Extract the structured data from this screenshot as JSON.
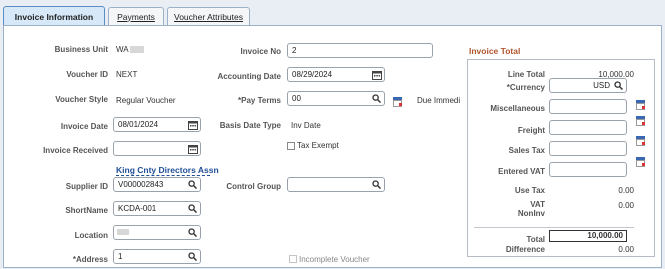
{
  "tabs": [
    {
      "label": "Invoice Information"
    },
    {
      "label": "Payments"
    },
    {
      "label": "Voucher Attributes"
    }
  ],
  "left": {
    "business_unit_label": "Business Unit",
    "business_unit_value": "WA",
    "voucher_id_label": "Voucher ID",
    "voucher_id_value": "NEXT",
    "voucher_style_label": "Voucher Style",
    "voucher_style_value": "Regular Voucher",
    "invoice_date_label": "Invoice Date",
    "invoice_date_value": "08/01/2024",
    "invoice_received_label": "Invoice Received",
    "invoice_received_value": "",
    "supplier_link": "King Cnty Directors Assn",
    "supplier_id_label": "Supplier ID",
    "supplier_id_value": "V000002843",
    "shortname_label": "ShortName",
    "shortname_value": "KCDA-001",
    "location_label": "Location",
    "location_value": "",
    "address_label": "*Address",
    "address_value": "1"
  },
  "middle": {
    "invoice_no_label": "Invoice No",
    "invoice_no_value": "2",
    "accounting_date_label": "Accounting Date",
    "accounting_date_value": "08/29/2024",
    "pay_terms_label": "*Pay Terms",
    "pay_terms_value": "00",
    "due_label": "Due Immedi",
    "basis_date_type_label": "Basis Date Type",
    "basis_date_type_value": "Inv Date",
    "tax_exempt_label": "Tax Exempt",
    "control_group_label": "Control Group",
    "control_group_value": "",
    "incomplete_voucher_label": "Incomplete Voucher"
  },
  "invoice_total": {
    "title": "Invoice Total",
    "line_total_label": "Line Total",
    "line_total_value": "10,000.00",
    "currency_label": "*Currency",
    "currency_value": "USD",
    "misc_label": "Miscellaneous",
    "freight_label": "Freight",
    "sales_tax_label": "Sales Tax",
    "entered_vat_label": "Entered VAT",
    "use_tax_label": "Use Tax",
    "use_tax_value": "0.00",
    "vat_noninv_label1": "VAT",
    "vat_noninv_label2": "NonInv",
    "vat_noninv_value": "0.00",
    "total_label": "Total",
    "total_value": "10,000.00",
    "difference_label": "Difference",
    "difference_value": "0.00"
  },
  "colors": {
    "accent": "#3a67b1",
    "section_title": "#b0562c",
    "link": "#1f4e97"
  }
}
